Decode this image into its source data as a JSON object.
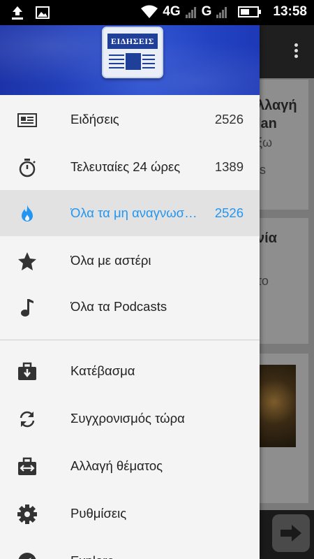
{
  "status_bar": {
    "time": "13:58",
    "network_1": "4G",
    "network_2": "G",
    "icons": [
      "upload-icon",
      "image-icon",
      "wifi-icon",
      "signal-icon",
      "battery-icon"
    ]
  },
  "drawer": {
    "logo_text": "ΕΙΔΗΣΕΙΣ",
    "items": [
      {
        "label": "Ειδήσεις",
        "count": "2526",
        "icon": "newspaper-icon"
      },
      {
        "label": "Τελευταίες 24 ώρες",
        "count": "1389",
        "icon": "stopwatch-icon"
      },
      {
        "label": "Όλα τα μη αναγνωσμένα",
        "count": "2526",
        "icon": "flame-icon",
        "active": true
      },
      {
        "label": "Όλα με αστέρι",
        "count": "",
        "icon": "star-icon"
      },
      {
        "label": "Όλα τα Podcasts",
        "count": "",
        "icon": "music-note-icon"
      }
    ],
    "actions": [
      {
        "label": "Κατέβασμα",
        "icon": "download-briefcase-icon"
      },
      {
        "label": "Συγχρονισμός τώρα",
        "icon": "sync-icon"
      },
      {
        "label": "Αλλαγή θέματος",
        "icon": "swap-theme-icon"
      },
      {
        "label": "Ρυθμίσεις",
        "icon": "gear-icon"
      },
      {
        "label": "Explore",
        "icon": "compass-icon"
      }
    ]
  },
  "background": {
    "card1_title": [
      "λλαγή",
      "lan"
    ],
    "card1_sub": [
      "ξω",
      "is"
    ],
    "card2_title": "νία",
    "card2_sub": "το"
  },
  "colors": {
    "accent": "#2196f3",
    "header_blue": "#2a4fd0",
    "drawer_bg": "#f4f4f4"
  }
}
